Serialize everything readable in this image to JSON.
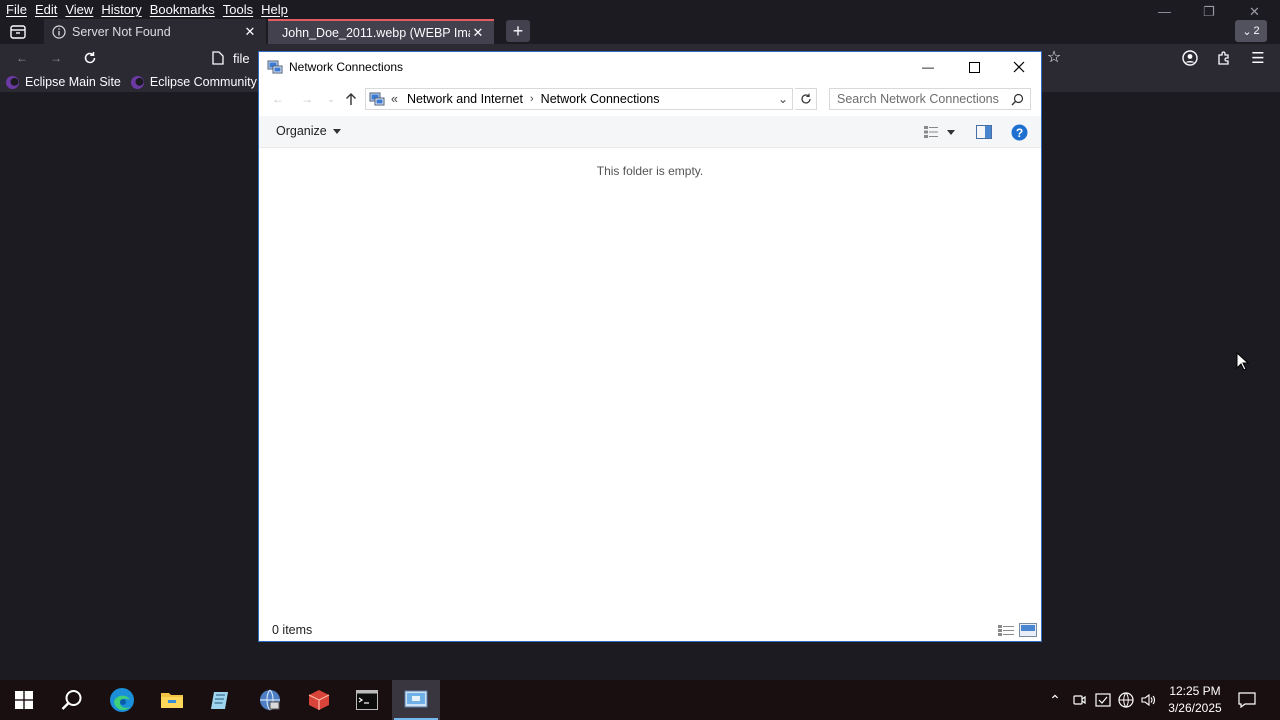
{
  "browser": {
    "menu": [
      "File",
      "Edit",
      "View",
      "History",
      "Bookmarks",
      "Tools",
      "Help"
    ],
    "tabs": [
      {
        "title": "Server Not Found",
        "active": false
      },
      {
        "title": "John_Doe_2011.webp (WEBP Image,",
        "active": true
      }
    ],
    "tab_overflow_count": "2",
    "url_text": "file",
    "bookmarks": [
      "Eclipse Main Site",
      "Eclipse Community"
    ],
    "colors": {
      "active_tab_accent": "#e25c62",
      "chrome_bg": "#1c1b22"
    }
  },
  "explorer": {
    "title": "Network Connections",
    "breadcrumb_overflow": "«",
    "breadcrumbs": [
      "Network and Internet",
      "Network Connections"
    ],
    "search_placeholder": "Search Network Connections",
    "organize_label": "Organize",
    "empty_message": "This folder is empty.",
    "status_items": "0 items",
    "colors": {
      "help_icon": "#1f6fd1",
      "border": "#2d6cc0"
    }
  },
  "taskbar": {
    "time": "12:25 PM",
    "date": "3/26/2025",
    "apps": [
      "start-icon",
      "search-icon",
      "edge-icon",
      "file-explorer-icon",
      "notepad-icon",
      "network-globe-icon",
      "app-red-icon",
      "terminal-icon",
      "network-connections-icon"
    ]
  }
}
